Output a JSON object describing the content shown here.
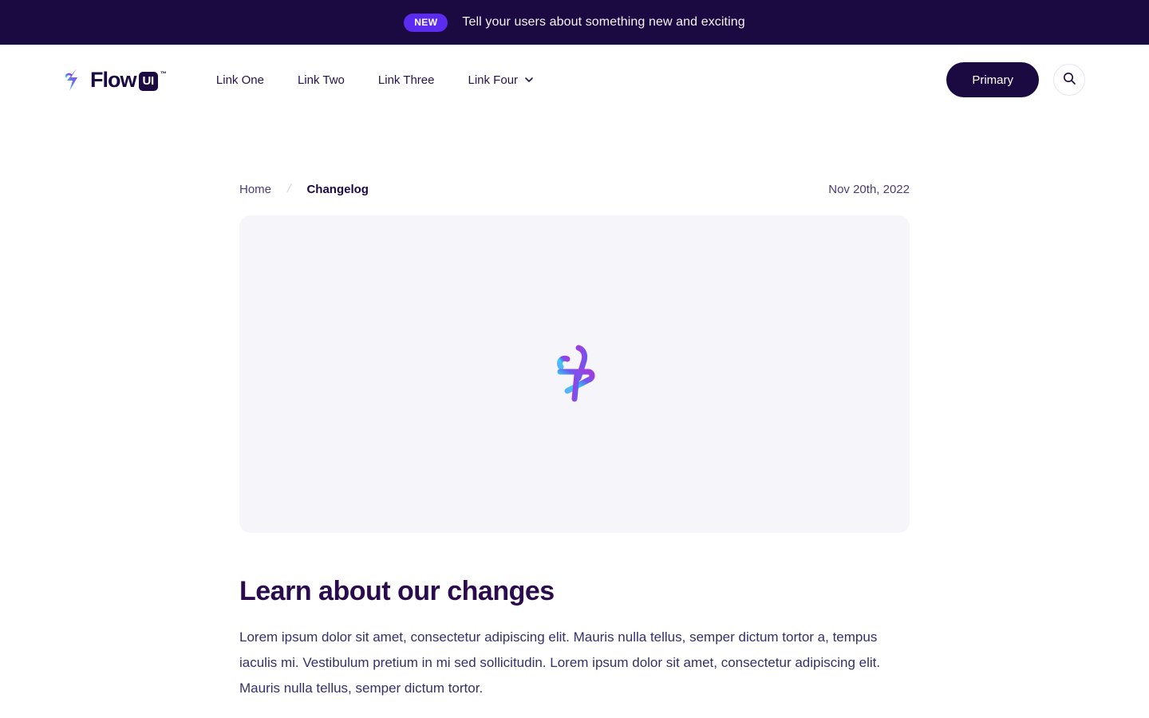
{
  "banner": {
    "badge": "NEW",
    "message": "Tell your users about something new and exciting",
    "bg_color": "#1B0A42",
    "badge_color": "#5B2BEF"
  },
  "header": {
    "logo": {
      "word": "Flow",
      "suffix": "UI",
      "trademark": "™",
      "mark_icon": "flow-bolt-icon"
    },
    "nav_links": [
      {
        "label": "Link One",
        "has_dropdown": false
      },
      {
        "label": "Link Two",
        "has_dropdown": false
      },
      {
        "label": "Link Three",
        "has_dropdown": false
      },
      {
        "label": "Link Four",
        "has_dropdown": true,
        "dropdown_icon": "chevron-down-icon"
      }
    ],
    "primary_button": "Primary",
    "search_icon": "search-icon"
  },
  "main": {
    "breadcrumb": {
      "home": "Home",
      "separator": "/",
      "current": "Changelog"
    },
    "date": "Nov 20th, 2022",
    "media": {
      "icon": "flow-bolt-3d-icon",
      "bg_color": "#F5F5FA"
    },
    "article": {
      "title": "Learn about our changes",
      "body": "Lorem ipsum dolor sit amet, consectetur adipiscing elit. Mauris nulla tellus, semper dictum tortor a, tempus iaculis mi. Vestibulum pretium in mi sed sollicitudin. Lorem ipsum dolor sit amet, consectetur adipiscing elit. Mauris nulla tellus, semper dictum tortor."
    }
  }
}
